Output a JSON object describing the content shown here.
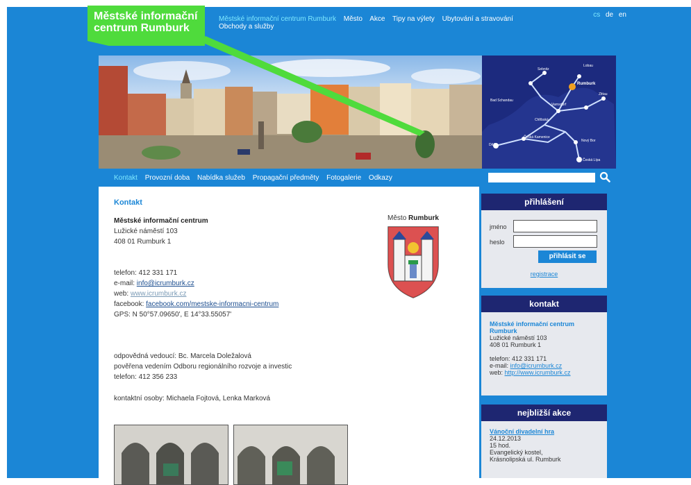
{
  "header": {
    "logo_line1": "Městské informační",
    "logo_line2": "centrum Rumburk",
    "nav": [
      "Městské informační centrum Rumburk",
      "Město",
      "Akce",
      "Tipy na výlety",
      "Ubytování a stravování",
      "Obchody a služby"
    ],
    "languages": [
      "cs",
      "de",
      "en"
    ]
  },
  "map_labels": [
    "Lobau",
    "Rumburk",
    "Zittau",
    "Sebnitz",
    "Bad Schandau",
    "Varnsdorf",
    "Chřibská",
    "Děčín",
    "Česká Kamenice",
    "Nový Bor",
    "Česká Lípa"
  ],
  "subnav": {
    "items": [
      "Kontakt",
      "Provozní doba",
      "Nabídka služeb",
      "Propagační předměty",
      "Fotogalerie",
      "Odkazy"
    ],
    "search_value": ""
  },
  "main": {
    "title": "Kontakt",
    "org_name": "Městské informační centrum",
    "street": "Lužické náměstí 103",
    "city": "408 01 Rumburk 1",
    "phone_label": "telefon:",
    "phone": "412 331 171",
    "email_label": "e-mail:",
    "email": "info@icrumburk.cz",
    "web_label": "web:",
    "web": "www.icrumburk.cz",
    "facebook_label": "facebook:",
    "facebook": "facebook.com/mestske-informacni-centrum",
    "gps": "GPS: N 50°57.09650', E 14°33.55057'",
    "manager": "odpovědná vedoucí: Bc. Marcela Doležalová",
    "manager_role": "pověřena vedením Odboru regionálního rozvoje a investic",
    "manager_phone": "telefon: 412 356 233",
    "contacts": "kontaktní osoby: Michaela Fojtová, Lenka Marková",
    "crest_title_light": "Město",
    "crest_title_bold": "Rumburk"
  },
  "login": {
    "title": "přihlášení",
    "name_label": "jméno",
    "password_label": "heslo",
    "name_value": "",
    "password_value": "",
    "button": "přihlásit se",
    "register": "registrace"
  },
  "contact_box": {
    "title": "kontakt",
    "org_name": "Městské informační centrum Rumburk",
    "street": "Lužické náměstí 103",
    "city": "408 01 Rumburk 1",
    "phone": "telefon: 412 331 171",
    "email_label": "e-mail:",
    "email": "info@icrumburk.cz",
    "web_label": "web:",
    "web": "http://www.icrumburk.cz"
  },
  "events": {
    "title": "nejbližší akce",
    "event_title": "Vánoční divadelní hra",
    "date": "24.12.2013",
    "time": "15 hod.",
    "place_line1": "Evangelický kostel,",
    "place_line2": "Krásnolipská ul. Rumburk"
  },
  "colors": {
    "page_blue": "#1b86d6",
    "logo_green": "#4fdb3c",
    "box_header_navy": "#1e2671",
    "active_cyan": "#7de8ff"
  }
}
